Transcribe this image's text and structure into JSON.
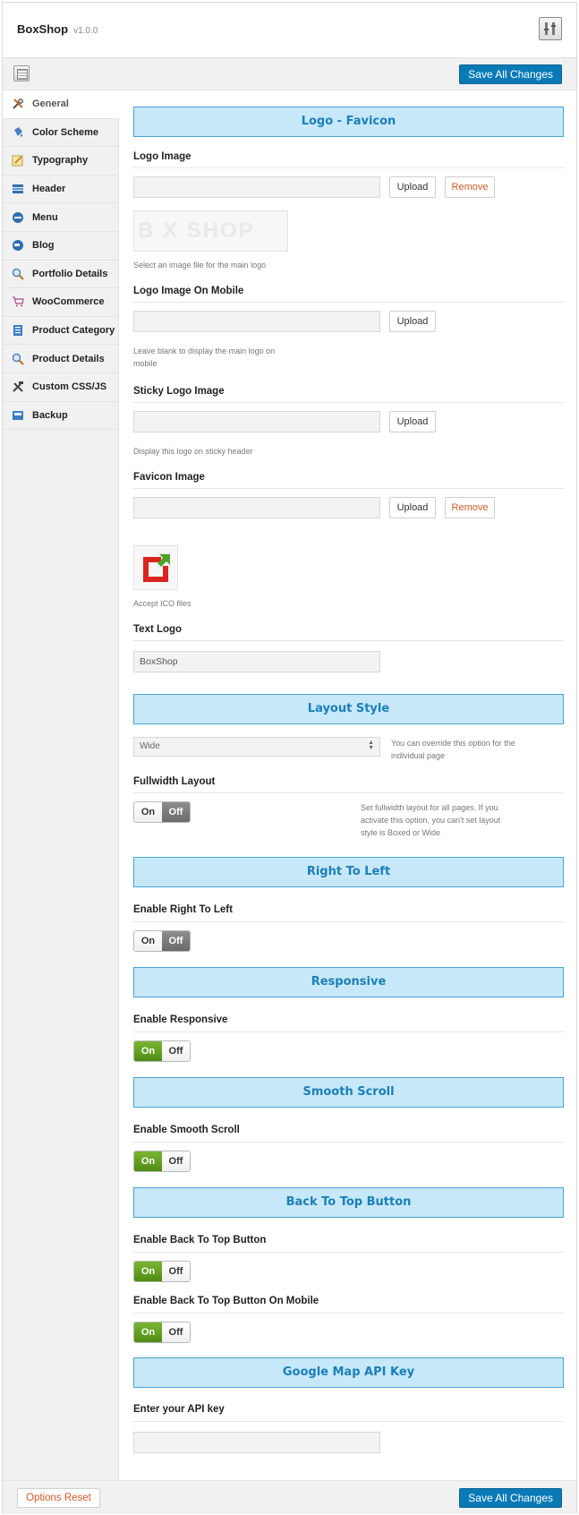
{
  "app": {
    "name": "BoxShop",
    "version": "v1.0.0"
  },
  "toolbar": {
    "save_label": "Save All Changes"
  },
  "sidebar": {
    "items": [
      {
        "label": "General",
        "icon": "tools-icon",
        "active": true
      },
      {
        "label": "Color Scheme",
        "icon": "paint-bucket-icon"
      },
      {
        "label": "Typography",
        "icon": "pencil-note-icon"
      },
      {
        "label": "Header",
        "icon": "header-bars-icon"
      },
      {
        "label": "Menu",
        "icon": "menu-circle-icon"
      },
      {
        "label": "Blog",
        "icon": "chat-bubble-icon"
      },
      {
        "label": "Portfolio Details",
        "icon": "magnifier-icon"
      },
      {
        "label": "WooCommerce",
        "icon": "cart-icon"
      },
      {
        "label": "Product Category",
        "icon": "list-document-icon"
      },
      {
        "label": "Product Details",
        "icon": "magnifier-icon"
      },
      {
        "label": "Custom CSS/JS",
        "icon": "hammer-wrench-icon"
      },
      {
        "label": "Backup",
        "icon": "backup-disk-icon"
      }
    ]
  },
  "sections": {
    "logo_favicon": "Logo - Favicon",
    "layout_style": "Layout Style",
    "rtl": "Right To Left",
    "responsive": "Responsive",
    "smooth_scroll": "Smooth Scroll",
    "back_to_top": "Back To Top Button",
    "google_map": "Google Map API Key"
  },
  "fields": {
    "logo_image": {
      "label": "Logo Image",
      "hint": "Select an image file for the main logo",
      "preview_text": "B  X SHOP"
    },
    "logo_mobile": {
      "label": "Logo Image On Mobile",
      "hint": "Leave blank to display the main logo on mobile"
    },
    "sticky_logo": {
      "label": "Sticky Logo Image",
      "hint": "Display this logo on sticky header"
    },
    "favicon": {
      "label": "Favicon Image",
      "hint": "Accept ICO files"
    },
    "text_logo": {
      "label": "Text Logo",
      "value": "BoxShop"
    },
    "layout_select": {
      "value": "Wide",
      "hint": "You can override this option for the individual page"
    },
    "fullwidth": {
      "label": "Fullwidth Layout",
      "hint": "Set fullwidth layout for all pages. If you activate this option, you can't set layout style is Boxed or Wide",
      "state": "off"
    },
    "rtl_toggle": {
      "label": "Enable Right To Left",
      "state": "off"
    },
    "responsive_toggle": {
      "label": "Enable Responsive",
      "state": "on"
    },
    "smooth_toggle": {
      "label": "Enable Smooth Scroll",
      "state": "on"
    },
    "back_top_toggle": {
      "label": "Enable Back To Top Button",
      "state": "on"
    },
    "back_top_mobile_toggle": {
      "label": "Enable Back To Top Button On Mobile",
      "state": "on"
    },
    "api_key": {
      "label": "Enter your API key",
      "value": ""
    }
  },
  "buttons": {
    "upload": "Upload",
    "remove": "Remove",
    "on": "On",
    "off": "Off",
    "reset": "Options Reset"
  },
  "colors": {
    "accent": "#0a7ab7",
    "section_bg": "#c7e8f8",
    "section_text": "#1b7fb7",
    "toggle_on": "#5c9a1c",
    "toggle_off": "#777777",
    "remove_text": "#d25b2a"
  }
}
